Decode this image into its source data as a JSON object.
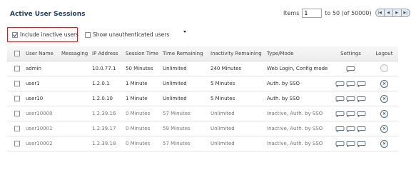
{
  "panel": {
    "title": "Active User Sessions"
  },
  "pager": {
    "items_label": "Items",
    "start_value": "1",
    "range_text": "to 50 (of 50000)",
    "buttons": [
      "|◀",
      "◀",
      "▶",
      "▶|"
    ]
  },
  "options": {
    "include_inactive": {
      "label": "Include inactive users",
      "checked": true
    },
    "show_unauthenticated": {
      "label": "Show unauthenticated users",
      "checked": false
    }
  },
  "table": {
    "headers": [
      "User Name",
      "Messaging",
      "IP Address",
      "Session Time",
      "Time Remaining",
      "Inactivity Remaining",
      "Type/Mode",
      "Settings",
      "Logout"
    ],
    "rows": [
      {
        "user": "admin",
        "messaging": "",
        "ip": "10.0.77.1",
        "session": "50 Minutes",
        "remaining": "Unlimited",
        "inactivity": "240 Minutes",
        "type": "Web Login, Config mode",
        "settings_count": 1,
        "logout": "disabled",
        "inactive": false
      },
      {
        "user": "user1",
        "messaging": "",
        "ip": "1.2.0.1",
        "session": "1 Minute",
        "remaining": "Unlimited",
        "inactivity": "5 Minutes",
        "type": "Auth. by SSO",
        "settings_count": 3,
        "logout": "enabled",
        "inactive": false
      },
      {
        "user": "user10",
        "messaging": "",
        "ip": "1.2.0.10",
        "session": "1 Minute",
        "remaining": "Unlimited",
        "inactivity": "5 Minutes",
        "type": "Auth. by SSO",
        "settings_count": 3,
        "logout": "enabled",
        "inactive": false
      },
      {
        "user": "user10000",
        "messaging": "",
        "ip": "1.2.39.16",
        "session": "0 Minutes",
        "remaining": "57 Minutes",
        "inactivity": "Unlimited",
        "type": "Inactive, Auth. by SSO",
        "settings_count": 3,
        "logout": "enabled",
        "inactive": true
      },
      {
        "user": "user10001",
        "messaging": "",
        "ip": "1.2.39.17",
        "session": "0 Minutes",
        "remaining": "59 Minutes",
        "inactivity": "Unlimited",
        "type": "Inactive, Auth. by SSO",
        "settings_count": 3,
        "logout": "enabled",
        "inactive": true
      },
      {
        "user": "user10002",
        "messaging": "",
        "ip": "1.2.39.18",
        "session": "0 Minutes",
        "remaining": "57 Minutes",
        "inactivity": "Unlimited",
        "type": "Inactive, Auth. by SSO",
        "settings_count": 3,
        "logout": "enabled",
        "inactive": true
      }
    ]
  },
  "icons": {
    "settings": "speech-bubble-icon",
    "logout": "close-circle-icon"
  },
  "colors": {
    "title": "#17406b",
    "highlight_border": "#d02020"
  }
}
